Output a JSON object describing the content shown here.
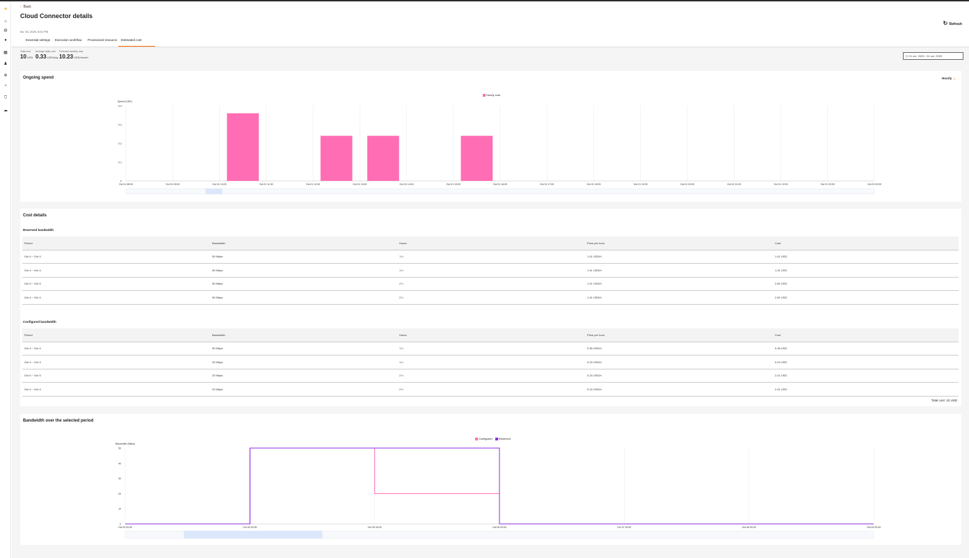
{
  "app": {
    "logo_glyph": "≡"
  },
  "sidebar": {
    "items": [
      {
        "icon": "home-icon",
        "glyph": "⌂"
      },
      {
        "icon": "globe-icon",
        "glyph": "◍"
      },
      {
        "icon": "location-icon",
        "glyph": "●"
      },
      {
        "icon": "grid-icon",
        "glyph": "▦"
      },
      {
        "icon": "user-icon",
        "glyph": "♟"
      },
      {
        "icon": "settings-icon",
        "glyph": "✲"
      },
      {
        "icon": "network-icon",
        "glyph": "⑂"
      },
      {
        "icon": "shield-icon",
        "glyph": "⛉"
      },
      {
        "icon": "cloud-icon",
        "glyph": "☁"
      }
    ]
  },
  "header": {
    "back_label": "Back",
    "title": "Cloud Connector details",
    "refresh_label": "Refresh",
    "created_date": "No. 03, 2025, 8:01 PM",
    "tabs": [
      {
        "label": "Essential settings",
        "active": false
      },
      {
        "label": "Execution workflow",
        "active": false
      },
      {
        "label": "Provisioned resource",
        "active": false
      },
      {
        "label": "Estimated cost",
        "active": true
      }
    ]
  },
  "stats": {
    "total": {
      "label": "Total cost",
      "value": "10",
      "unit": "USD"
    },
    "average": {
      "label": "Average daily cost",
      "value": "0.33",
      "unit": "USD/day"
    },
    "forecast": {
      "label": "Forecast monthly cost",
      "value": "10.23",
      "unit": "USD/month"
    },
    "date_range": "01 oct. 2025 - 04 oct. 2025"
  },
  "ongoing": {
    "title": "Ongoing spend",
    "granularity": "Hourly",
    "legend": "Hourly cost"
  },
  "chart_data": [
    {
      "type": "bar",
      "legend": [
        "Hourly cost"
      ],
      "ylabel": "Spend (USD)",
      "ylim": [
        0,
        0.4
      ],
      "yticks": [
        "0",
        "0.1",
        "0.2",
        "0.3",
        "0.4"
      ],
      "categories": [
        "Oct 01 08:00",
        "Oct 01 09:00",
        "Oct 01 10:00",
        "Oct 01 11:00",
        "Oct 01 12:00",
        "Oct 01 13:00",
        "Oct 01 14:00",
        "Oct 01 15:00",
        "Oct 01 16:00",
        "Oct 01 17:00",
        "Oct 01 18:00",
        "Oct 01 19:00",
        "Oct 01 20:00",
        "Oct 01 21:00",
        "Oct 01 22:00",
        "Oct 01 23:00",
        "Oct 02 00:00"
      ],
      "values": [
        0,
        0,
        0.36,
        0,
        0.24,
        0.24,
        0,
        0.24,
        0,
        0,
        0,
        0,
        0,
        0,
        0,
        0
      ],
      "colors": {
        "bar": "#ff6eb4"
      },
      "grid": true,
      "legend_position": "top-center"
    },
    {
      "type": "line",
      "title": "Bandwidth over the selected period",
      "ylabel": "Bandwidth (Mbps)",
      "ylim": [
        0,
        50
      ],
      "yticks": [
        "0",
        "10",
        "20",
        "30",
        "40",
        "50"
      ],
      "xticks": [
        "Oct 03 00:00",
        "Oct 04 00:00",
        "Oct 05 00:00",
        "Oct 06 00:00",
        "Oct 07 00:00",
        "Oct 08 00:00",
        "Oct 09 00:00"
      ],
      "series": [
        {
          "name": "Configured",
          "color": "#ff6eb4",
          "points": [
            [
              0,
              0
            ],
            [
              1,
              0
            ],
            [
              1,
              50
            ],
            [
              2,
              50
            ],
            [
              2,
              20
            ],
            [
              3,
              20
            ],
            [
              3,
              0
            ],
            [
              6,
              0
            ]
          ]
        },
        {
          "name": "Reserved",
          "color": "#8a2be2",
          "points": [
            [
              0,
              0
            ],
            [
              1,
              0
            ],
            [
              1,
              50
            ],
            [
              3,
              50
            ],
            [
              3,
              0
            ],
            [
              6,
              0
            ]
          ]
        }
      ],
      "grid": true,
      "legend_position": "top-center"
    }
  ],
  "cost_details": {
    "title": "Cost details",
    "reserved": {
      "title": "Reserved bandwidth",
      "headers": [
        "Period",
        "Bandwidth",
        "Hours",
        "Price per hour",
        "Cost"
      ],
      "rows": [
        [
          "Oct 4 ~ Oct 4",
          "50 Mbps",
          "1 h",
          "1.41 USD/h",
          "1.41 USD"
        ],
        [
          "Oct 4 ~ Oct 4",
          "50 Mbps",
          "1 h",
          "1.41 USD/h",
          "1.41 USD"
        ],
        [
          "Oct 5 ~ Oct 5",
          "50 Mbps",
          "2 h",
          "1.41 USD/h",
          "2.82 USD"
        ],
        [
          "Oct 4 ~ Oct 4",
          "50 Mbps",
          "2 h",
          "1.41 USD/h",
          "2.82 USD"
        ]
      ]
    },
    "configured": {
      "title": "Configured bandwidth",
      "headers": [
        "Period",
        "Bandwidth",
        "Hours",
        "Price per hour",
        "Cost"
      ],
      "rows": [
        [
          "Oct 4 ~ Oct 4",
          "50 Mbps",
          "1 h",
          "0.36 USD/h",
          "0.36 USD"
        ],
        [
          "Oct 4 ~ Oct 4",
          "20 Mbps",
          "1 h",
          "0.24 USD/h",
          "0.24 USD"
        ],
        [
          "Oct 5 ~ Oct 5",
          "20 Mbps",
          "2 h",
          "0.24 USD/h",
          "2.41 USD"
        ],
        [
          "Oct 4 ~ Oct 4",
          "20 Mbps",
          "2 h",
          "0.24 USD/h",
          "2.41 USD"
        ]
      ]
    },
    "total_label": "Total cost: 10 USD"
  },
  "bandwidth": {
    "title": "Bandwidth over the selected period",
    "legend_configured": "Configured",
    "legend_reserved": "Reserved"
  }
}
